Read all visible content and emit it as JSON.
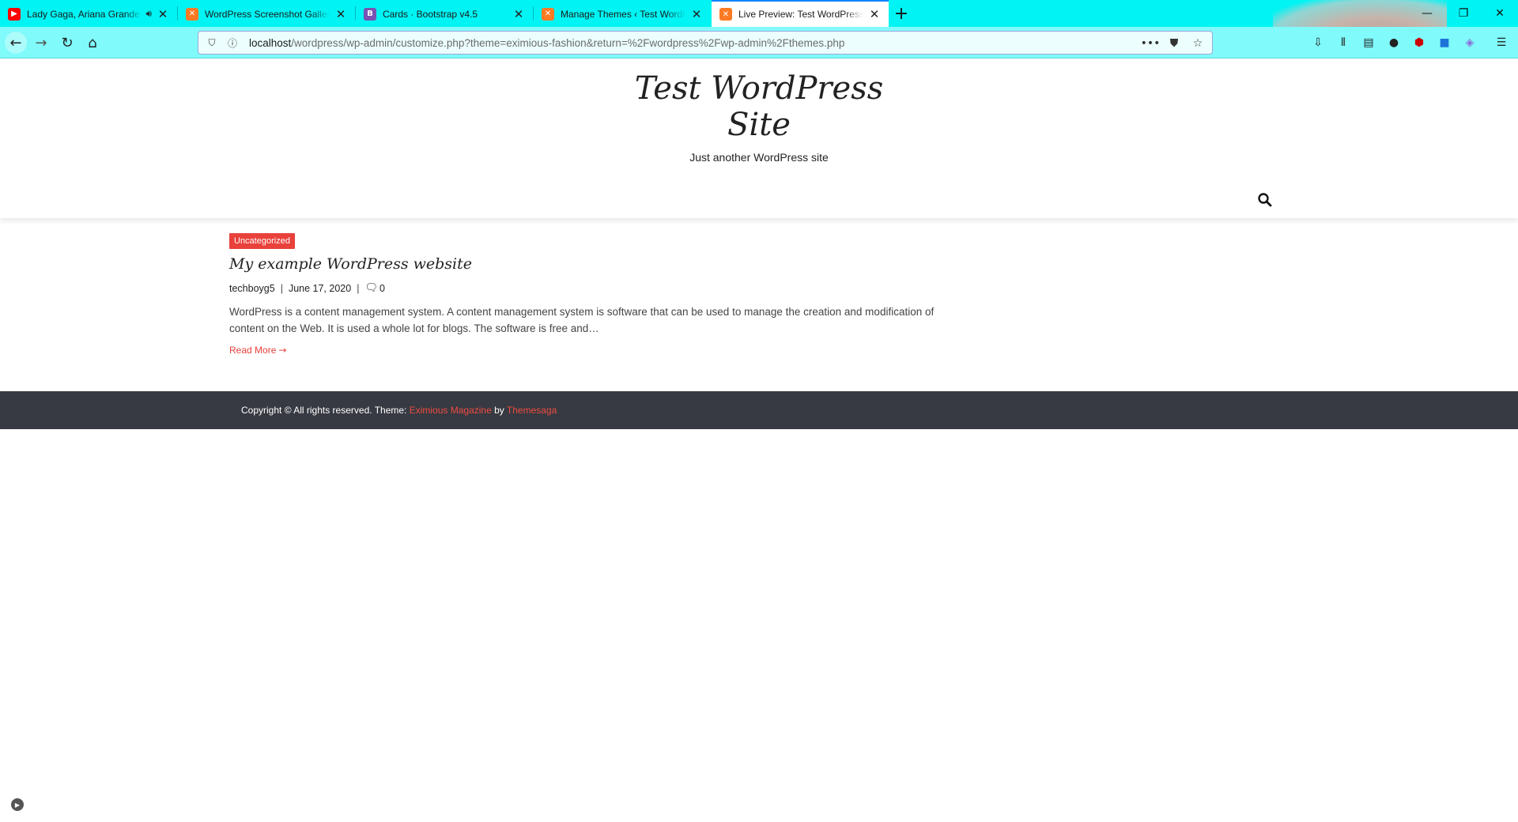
{
  "browser": {
    "tabs": [
      {
        "label": "Lady Gaga, Ariana Grande",
        "icon": "youtube-icon",
        "icon_color": "#ff0000",
        "audio": true,
        "active": false
      },
      {
        "label": "WordPress Screenshot Gallery",
        "icon": "xampp-icon",
        "icon_color": "#fb7a24",
        "active": false
      },
      {
        "label": "Cards · Bootstrap v4.5",
        "icon": "bootstrap-icon",
        "icon_color": "#7952b3",
        "icon_text": "B",
        "active": false
      },
      {
        "label": "Manage Themes ‹ Test WordPress",
        "icon": "xampp-icon",
        "icon_color": "#fb7a24",
        "active": false
      },
      {
        "label": "Live Preview: Test WordPress Site",
        "icon": "xampp-icon",
        "icon_color": "#fb7a24",
        "active": true
      }
    ],
    "url_host": "localhost",
    "url_path": "/wordpress/wp-admin/customize.php?theme=eximious-fashion&return=%2Fwordpress%2Fwp-admin%2Fthemes.php",
    "tabbar_color": "#00f4f4",
    "toolbar_color": "#80fafa"
  },
  "site": {
    "title": "Test WordPress Site",
    "tagline": "Just another WordPress site"
  },
  "post": {
    "category": "Uncategorized",
    "title": "My example WordPress website",
    "author": "techboyg5",
    "date": "June 17, 2020",
    "comments": "0",
    "excerpt": "WordPress is a content management system. A content management system is software that can be used to manage the creation and modification of content on the Web. It is used a whole lot for blogs. The software is free and…",
    "read_more": "Read More"
  },
  "footer": {
    "prefix": "Copyright © All rights reserved. Theme: ",
    "theme_link": "Eximious Magazine",
    "by": " by ",
    "author_link": "Themesaga"
  },
  "colors": {
    "accent": "#e9413b",
    "footer_bg": "#373a42"
  }
}
